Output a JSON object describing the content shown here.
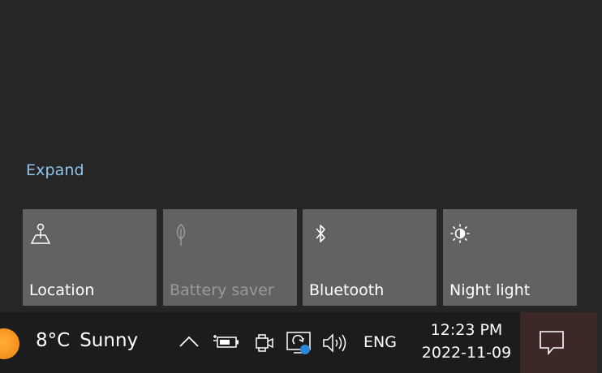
{
  "action_center": {
    "expand_label": "Expand",
    "tiles": [
      {
        "label": "Location",
        "icon": "location-icon",
        "enabled": true
      },
      {
        "label": "Battery saver",
        "icon": "battery-saver-icon",
        "enabled": false
      },
      {
        "label": "Bluetooth",
        "icon": "bluetooth-icon",
        "enabled": true
      },
      {
        "label": "Night light",
        "icon": "night-light-icon",
        "enabled": true
      }
    ]
  },
  "taskbar": {
    "weather": {
      "temperature": "8°C",
      "condition": "Sunny"
    },
    "tray_icons": [
      "chevron-up-icon",
      "battery-charging-icon",
      "meet-now-icon",
      "display-update-icon",
      "volume-icon"
    ],
    "language": "ENG",
    "clock": {
      "time": "12:23 PM",
      "date": "2022-11-09"
    },
    "notification_icon": "notification-icon"
  },
  "colors": {
    "background": "#262626",
    "tile": "#626262",
    "link": "#8fc6ee",
    "taskbar": "#1c1c1c",
    "weather_sun": "#f79420",
    "notification_badge": "#2b88d8"
  }
}
